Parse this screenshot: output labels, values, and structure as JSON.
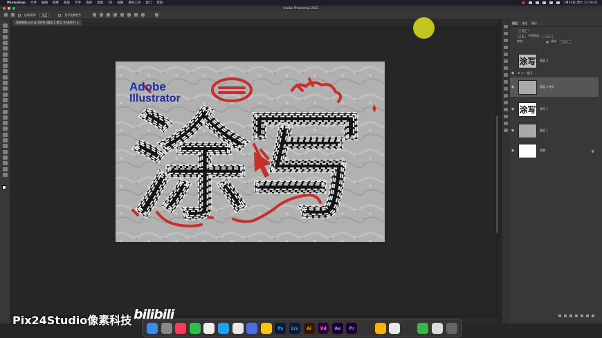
{
  "menubar": {
    "items": [
      "Photoshop",
      "文件",
      "编辑",
      "图像",
      "图层",
      "文字",
      "选择",
      "滤镜",
      "3D",
      "视图",
      "增效工具",
      "窗口",
      "帮助"
    ],
    "clock": "7月24日 周六 22:50:21"
  },
  "window": {
    "title": "Adobe Photoshop 2021"
  },
  "options_bar": {
    "auto_select_label": "自动选择:",
    "auto_select_value": "图层",
    "show_transform_label": "显示变换控件"
  },
  "document": {
    "tab_label": "涂鸦效果.psd @ 100% (图层 1 拷贝, RGB/8#)"
  },
  "artwork": {
    "logo_line1": "Adobe",
    "logo_line2": "Illustrator",
    "big_text": "涂写"
  },
  "layers_panel": {
    "tabs": [
      "图层",
      "通道",
      "路径"
    ],
    "kind_label": "Q 类型",
    "blend_mode": "正常",
    "opacity_label": "不透明度:",
    "opacity_value": "100%",
    "lock_label": "锁定:",
    "fill_label": "填充:",
    "fill_value": "100%",
    "layers": [
      {
        "name": "图层 3",
        "selected": false,
        "visible": false
      },
      {
        "name": "组 1",
        "selected": false,
        "visible": true
      },
      {
        "name": "图层 1 拷贝",
        "selected": true,
        "visible": true
      },
      {
        "name": "涂写 1",
        "selected": false,
        "visible": true
      },
      {
        "name": "图层 1",
        "selected": false,
        "visible": true
      },
      {
        "name": "背景",
        "selected": false,
        "visible": true
      }
    ]
  },
  "watermark": {
    "text": "Pix24Studio像素科技",
    "bili": "bilibili"
  },
  "dock": {
    "apps": [
      "Finder",
      "Launchpad",
      "Music",
      "WeChat",
      "QQ",
      "Safari",
      "Chrome",
      "Keynote",
      "Notes",
      "Ps",
      "Lrc",
      "Ai",
      "Xd",
      "Ae",
      "Pr",
      "Final Cut",
      "Sketch",
      "Chrome2",
      "Screenshot",
      "Phone",
      "Preview",
      "Trash"
    ],
    "labels": {
      "ps": "Ps",
      "lrc": "Lrc",
      "ai": "Ai",
      "xd": "Xd",
      "ae": "Ae",
      "pr": "Pr"
    }
  },
  "colors": {
    "accent_red": "#c7302a",
    "ink": "#111111",
    "logo_blue": "#1e2fa8",
    "paper": "#bdbdbd"
  }
}
